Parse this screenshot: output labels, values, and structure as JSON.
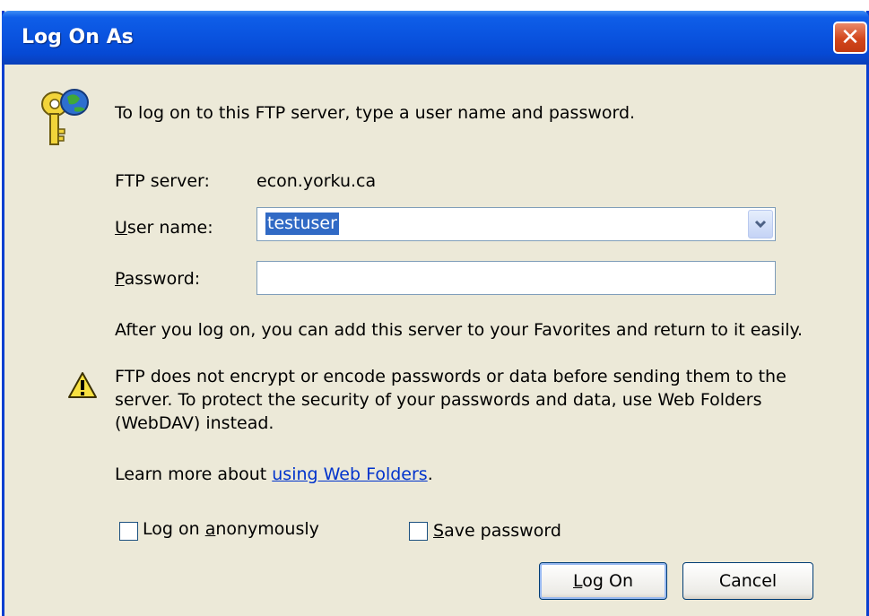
{
  "window": {
    "title": "Log On As"
  },
  "intro_text": "To log on to this FTP server, type a user name and password.",
  "server": {
    "label": "FTP server:",
    "value": "econ.yorku.ca"
  },
  "username": {
    "label_accel": "U",
    "label_rest": "ser name:",
    "value": "testuser"
  },
  "password": {
    "label_accel": "P",
    "label_rest": "assword:",
    "value": ""
  },
  "favorites_note": "After you log on, you can add this server to your Favorites and return to it easily.",
  "warning": {
    "line1": "FTP does not encrypt or encode passwords or data before sending them to the",
    "line2": "server.  To protect the security of your passwords and data, use Web Folders",
    "line3": "(WebDAV) instead."
  },
  "learn_more": {
    "prefix": "Learn more about ",
    "link": "using Web Folders",
    "suffix": "."
  },
  "options": {
    "anonymous": {
      "pre": "Log on ",
      "accel": "a",
      "post": "nonymously",
      "checked": false
    },
    "save_password": {
      "pre": "",
      "accel": "S",
      "post": "ave password",
      "checked": false
    }
  },
  "buttons": {
    "logon": {
      "accel": "L",
      "rest": "og On"
    },
    "cancel": "Cancel"
  },
  "colors": {
    "titlebar": "#0a54e0",
    "dialog_bg": "#ece9d8",
    "selection": "#316ac5",
    "link": "#0033cc"
  }
}
